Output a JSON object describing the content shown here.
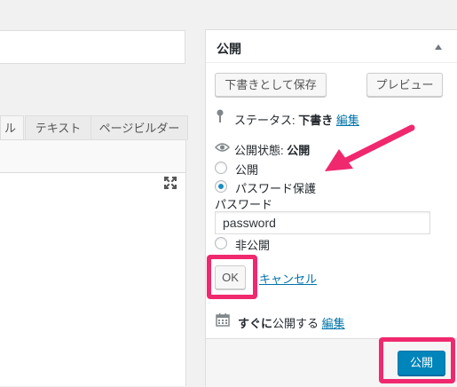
{
  "editor": {
    "tabs": [
      "ル",
      "テキスト",
      "ページビルダー"
    ]
  },
  "publish_box": {
    "title": "公開",
    "save_draft_label": "下書きとして保存",
    "preview_label": "プレビュー",
    "status_label": "ステータス: ",
    "status_value": "下書き",
    "status_edit": "編集",
    "visibility_label": "公開状態: ",
    "visibility_value": "公開",
    "options": [
      {
        "label": "公開",
        "checked": false
      },
      {
        "label": "パスワード保護",
        "checked": true
      },
      {
        "label": "非公開",
        "checked": false
      }
    ],
    "password_label": "パスワード",
    "password_value": "password",
    "ok_label": "OK",
    "cancel_label": "キャンセル",
    "schedule_bold": "すぐに",
    "schedule_text": "公開する",
    "schedule_edit": "編集",
    "publish_label": "公開"
  },
  "colors": {
    "accent": "#0085ba",
    "highlight": "#f0286e",
    "link": "#0073aa"
  },
  "icons": [
    "fullscreen-icon",
    "toggle-arrow-icon",
    "pin-icon",
    "eye-icon",
    "calendar-icon"
  ]
}
